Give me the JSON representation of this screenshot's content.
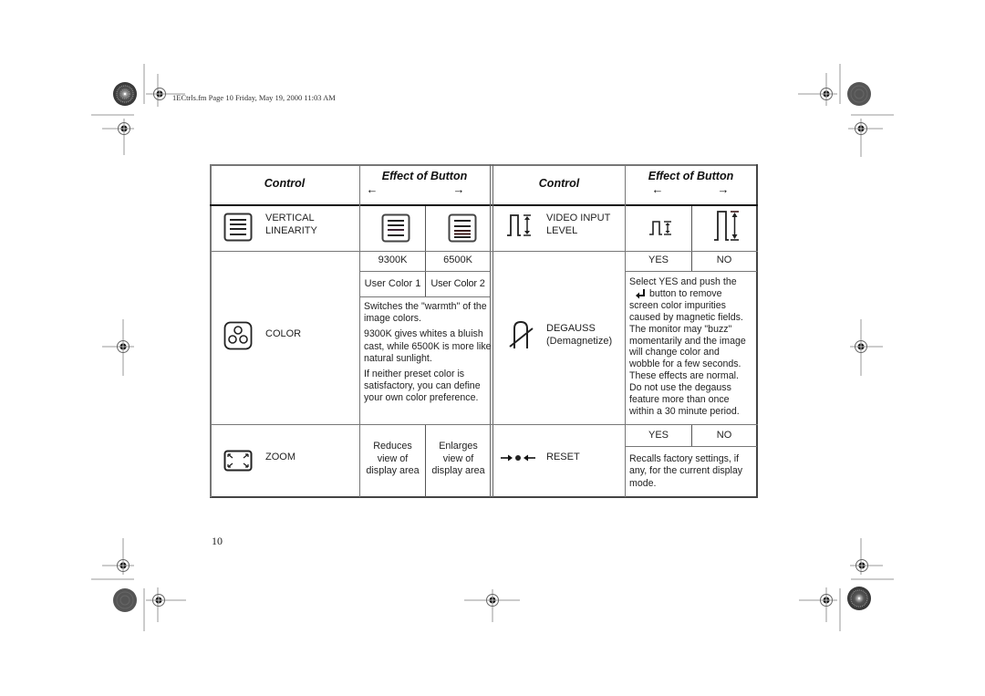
{
  "running_header": "1ECtrls.fm  Page 10  Friday, May 19, 2000  11:03 AM",
  "page_number": "10",
  "table": {
    "header": {
      "control_label": "Control",
      "effect_label": "Effect of Button",
      "left_arrow": "←",
      "right_arrow": "→"
    },
    "left": [
      {
        "icon": "vertical-linearity-icon",
        "name_line1": "VERTICAL",
        "name_line2": "LINEARITY",
        "left_effect_icon": "vertical-linearity-compressed-icon",
        "right_effect_icon": "vertical-linearity-expanded-icon"
      },
      {
        "icon": "color-icon",
        "name": "COLOR",
        "options_row1": [
          "9300K",
          "6500K"
        ],
        "options_row2": [
          "User Color 1",
          "User Color 2"
        ],
        "description": [
          "Switches the \"warmth\" of the image colors.",
          "9300K gives whites a bluish cast, while 6500K is more like natural sunlight.",
          "If neither preset color is satisfactory, you can define your own color preference."
        ]
      },
      {
        "icon": "zoom-icon",
        "name": "ZOOM",
        "left_effect": [
          "Reduces",
          "view of",
          "display area"
        ],
        "right_effect": [
          "Enlarges",
          "view of",
          "display area"
        ]
      }
    ],
    "right": [
      {
        "icon": "video-input-level-icon",
        "name_line1": "VIDEO INPUT",
        "name_line2": "LEVEL",
        "left_effect_icon": "video-level-low-icon",
        "right_effect_icon": "video-level-high-icon"
      },
      {
        "icon": "degauss-icon",
        "name_line1": "DEGAUSS",
        "name_line2": "(Demagnetize)",
        "options": [
          "YES",
          "NO"
        ],
        "description_lines": [
          "Select YES and push the",
          "button to remove",
          "screen color impurities",
          "caused by magnetic fields.",
          "The monitor may \"buzz\"",
          "momentarily and the image",
          "will change color and",
          "wobble for a few seconds.",
          "These effects are normal.",
          "Do not use the degauss",
          "feature more than once",
          "within a 30 minute period."
        ]
      },
      {
        "icon": "reset-icon",
        "name": "RESET",
        "options": [
          "YES",
          "NO"
        ],
        "description_lines": [
          "Recalls factory settings, if",
          "any, for the current display",
          "mode."
        ]
      }
    ]
  }
}
